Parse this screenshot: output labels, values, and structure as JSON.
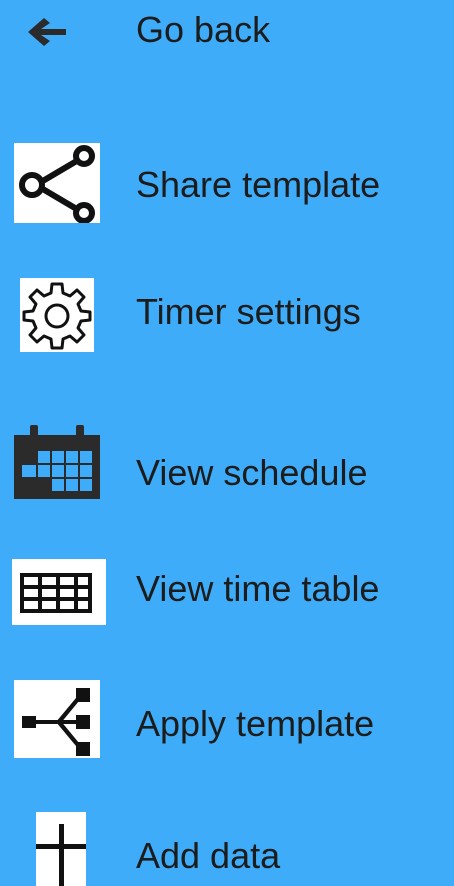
{
  "menu": {
    "items": [
      {
        "label": "Go back",
        "icon": "arrow-left-icon"
      },
      {
        "label": "Share template",
        "icon": "share-icon"
      },
      {
        "label": "Timer settings",
        "icon": "gear-icon"
      },
      {
        "label": "View schedule",
        "icon": "calendar-icon"
      },
      {
        "label": "View time table",
        "icon": "table-grid-icon"
      },
      {
        "label": "Apply template",
        "icon": "apply-template-icon"
      },
      {
        "label": "Add data",
        "icon": "plus-icon"
      }
    ]
  },
  "colors": {
    "background": "#3eacf9",
    "text": "#1c1c1c",
    "icon": "#2b2b2b",
    "icon_background": "#ffffff"
  }
}
